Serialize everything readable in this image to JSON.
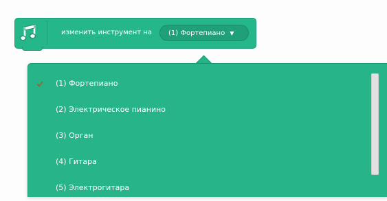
{
  "block": {
    "label": "изменить инструмент на",
    "selected_value": "(1) Фортепиано",
    "extension_icon": "music-notes-icon",
    "color": "#25b789"
  },
  "menu": {
    "items": [
      {
        "label": "(1) Фортепиано",
        "selected": true
      },
      {
        "label": "(2) Электрическое пианино",
        "selected": false
      },
      {
        "label": "(3) Орган",
        "selected": false
      },
      {
        "label": "(4) Гитара",
        "selected": false
      },
      {
        "label": "(5) Электрогитара",
        "selected": false
      }
    ],
    "check_icon": "checkmark-icon",
    "background_color": "#27b489",
    "scrollbar_color": "#e1e1e1"
  }
}
